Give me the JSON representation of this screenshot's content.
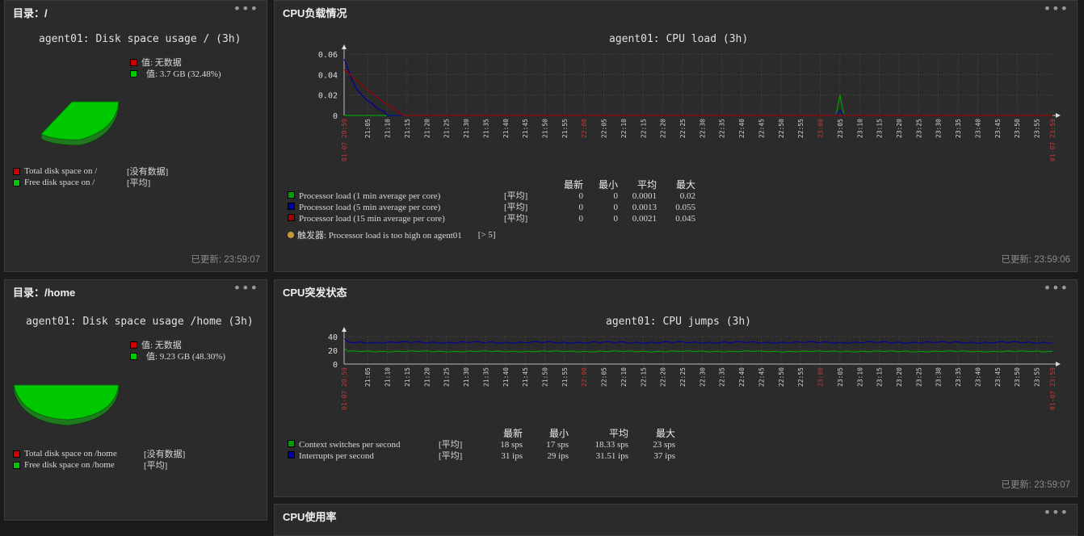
{
  "widgets": {
    "disk_root": {
      "title": "目录：/",
      "menu": "•••",
      "graph_title": "agent01: Disk space usage / (3h)",
      "legend_top": [
        {
          "label": "值: 无数据",
          "color": "#cc0000"
        },
        {
          "label": "值: 3.7 GB (32.48%)",
          "color": "#00c800"
        }
      ],
      "legend_bottom": [
        {
          "name": "Total disk space on /",
          "value": "[没有数据]",
          "color": "#cc0000"
        },
        {
          "name": "Free disk space on /",
          "value": "[平均]",
          "color": "#00c800"
        }
      ],
      "pie_free_pct": 32.48,
      "updated": "已更新: 23:59:07"
    },
    "disk_home": {
      "title": "目录：/home",
      "menu": "•••",
      "graph_title": "agent01: Disk space usage /home (3h)",
      "legend_top": [
        {
          "label": "值: 无数据",
          "color": "#cc0000"
        },
        {
          "label": "值: 9.23 GB (48.30%)",
          "color": "#00c800"
        }
      ],
      "legend_bottom": [
        {
          "name": "Total disk space on /home",
          "value": "[没有数据]",
          "color": "#cc0000"
        },
        {
          "name": "Free disk space on /home",
          "value": "[平均]",
          "color": "#00c800"
        }
      ],
      "pie_free_pct": 48.3
    },
    "cpu_load": {
      "title": "CPU负载情况",
      "menu": "•••",
      "graph_title": "agent01: CPU load (3h)",
      "headers": [
        "最新",
        "最小",
        "平均",
        "最大"
      ],
      "rows": [
        {
          "name": "Processor load (1 min average per core)",
          "func": "[平均]",
          "last": "0",
          "min": "0",
          "avg": "0.0001",
          "max": "0.02",
          "color": "#00a000"
        },
        {
          "name": "Processor load (5 min average per core)",
          "func": "[平均]",
          "last": "0",
          "min": "0",
          "avg": "0.0013",
          "max": "0.055",
          "color": "#0000a0"
        },
        {
          "name": "Processor load (15 min average per core)",
          "func": "[平均]",
          "last": "0",
          "min": "0",
          "avg": "0.0021",
          "max": "0.045",
          "color": "#a00000"
        }
      ],
      "trigger": "触发器: Processor load is too high on agent01",
      "trigger_value": "[> 5]",
      "updated": "已更新: 23:59:06"
    },
    "cpu_jumps": {
      "title": "CPU突发状态",
      "menu": "•••",
      "graph_title": "agent01: CPU jumps (3h)",
      "headers": [
        "最新",
        "最小",
        "平均",
        "最大"
      ],
      "rows": [
        {
          "name": "Context switches per second",
          "func": "[平均]",
          "last": "18 sps",
          "min": "17 sps",
          "avg": "18.33 sps",
          "max": "23 sps",
          "color": "#00a000"
        },
        {
          "name": "Interrupts per second",
          "func": "[平均]",
          "last": "31 ips",
          "min": "29 ips",
          "avg": "31.51 ips",
          "max": "37 ips",
          "color": "#0000a0"
        }
      ],
      "updated": "已更新: 23:59:07"
    },
    "cpu_usage": {
      "title": "CPU使用率",
      "menu": "•••"
    }
  },
  "chart_data": [
    {
      "type": "line",
      "title": "agent01: CPU load (3h)",
      "yticks": [
        "0.06",
        "0.04",
        "0.02",
        "0"
      ],
      "ylim": [
        0,
        0.06
      ],
      "start_label": "01-07 20:59",
      "end_label": "01-07 23:59",
      "x_labels": [
        "21:05",
        "21:10",
        "21:15",
        "21:20",
        "21:25",
        "21:30",
        "21:35",
        "21:40",
        "21:45",
        "21:50",
        "21:55",
        "22:00",
        "22:05",
        "22:10",
        "22:15",
        "22:20",
        "22:25",
        "22:30",
        "22:35",
        "22:40",
        "22:45",
        "22:50",
        "22:55",
        "23:00",
        "23:05",
        "23:10",
        "23:15",
        "23:20",
        "23:25",
        "23:30",
        "23:35",
        "23:40",
        "23:45",
        "23:50",
        "23:55"
      ],
      "series": [
        {
          "name": "Processor load (1 min average per core)",
          "color": "#00a000",
          "x": [
            "20:59",
            "21:09",
            "21:10",
            "23:04",
            "23:05",
            "23:06",
            "23:59"
          ],
          "values": [
            0.0,
            0.0,
            0.0,
            0.0,
            0.02,
            0.0,
            0.0
          ]
        },
        {
          "name": "Processor load (5 min average per core)",
          "color": "#0000a0",
          "x": [
            "20:59",
            "21:00",
            "21:01",
            "21:02",
            "21:03",
            "21:04",
            "21:05",
            "21:06",
            "21:07",
            "21:08",
            "21:09",
            "21:10",
            "23:04",
            "23:05",
            "23:06",
            "23:59"
          ],
          "values": [
            0.055,
            0.045,
            0.035,
            0.027,
            0.022,
            0.018,
            0.014,
            0.012,
            0.008,
            0.006,
            0.004,
            0.0,
            0.0,
            0.005,
            0.0,
            0.0
          ]
        },
        {
          "name": "Processor load (15 min average per core)",
          "color": "#a00000",
          "x": [
            "20:59",
            "21:02",
            "21:05",
            "21:08",
            "21:11",
            "21:14",
            "23:59"
          ],
          "values": [
            0.045,
            0.035,
            0.025,
            0.016,
            0.008,
            0.0,
            0.0
          ]
        }
      ]
    },
    {
      "type": "line",
      "title": "agent01: CPU jumps (3h)",
      "yticks": [
        "40",
        "20",
        "0"
      ],
      "ylim": [
        0,
        40
      ],
      "start_label": "01-07 20:59",
      "end_label": "01-07 23:59",
      "x_labels": [
        "21:05",
        "21:10",
        "21:15",
        "21:20",
        "21:25",
        "21:30",
        "21:35",
        "21:40",
        "21:45",
        "21:50",
        "21:55",
        "22:00",
        "22:05",
        "22:10",
        "22:15",
        "22:20",
        "22:25",
        "22:30",
        "22:35",
        "22:40",
        "22:45",
        "22:50",
        "22:55",
        "23:00",
        "23:05",
        "23:10",
        "23:15",
        "23:20",
        "23:25",
        "23:30",
        "23:35",
        "23:40",
        "23:45",
        "23:50",
        "23:55"
      ],
      "series": [
        {
          "name": "Context switches per second",
          "color": "#00a000",
          "avg": 18.33,
          "min": 17,
          "max": 23
        },
        {
          "name": "Interrupts per second",
          "color": "#0000a0",
          "avg": 31.51,
          "min": 29,
          "max": 37
        }
      ]
    }
  ]
}
